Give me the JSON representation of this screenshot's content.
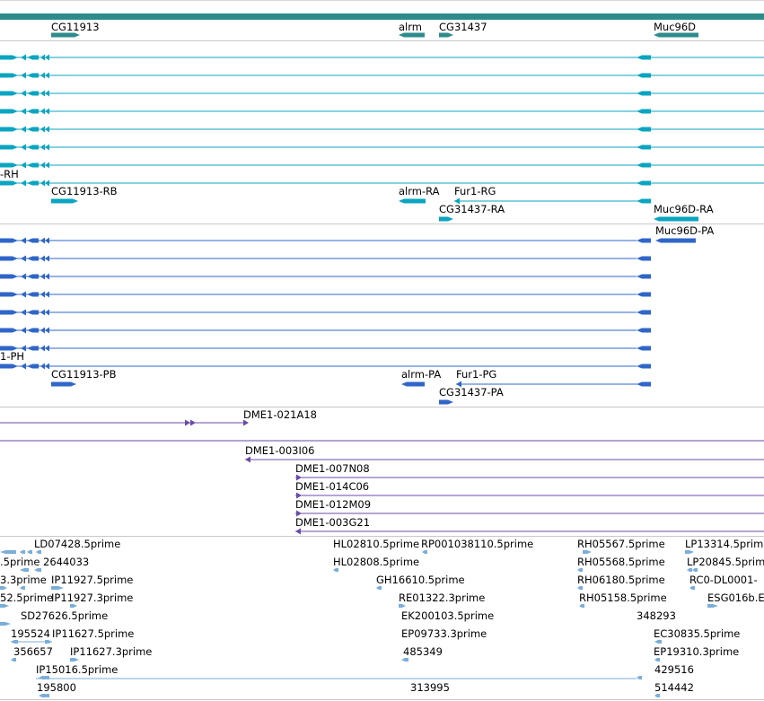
{
  "colors": {
    "gene": "#2e8b8b",
    "tx1": "#0aa5c0",
    "tx2": "#2f66c8",
    "clone": "#6a4aa8",
    "est": "#7aaed8",
    "divider": "#c8c8c8",
    "bar": "#2e8b8b"
  },
  "genes": [
    {
      "label": "CG11913"
    },
    {
      "label": "alrm"
    },
    {
      "label": "CG31437"
    },
    {
      "label": "Muc96D"
    }
  ],
  "tx1_labels": [
    {
      "label": "-RH"
    },
    {
      "label": "CG11913-RB"
    },
    {
      "label": "alrm-RA"
    },
    {
      "label": "Fur1-RG"
    },
    {
      "label": "CG31437-RA"
    },
    {
      "label": "Muc96D-RA"
    }
  ],
  "tx2_labels": [
    {
      "label": "Muc96D-PA"
    },
    {
      "label": "1-PH"
    },
    {
      "label": "CG11913-PB"
    },
    {
      "label": "alrm-PA"
    },
    {
      "label": "Fur1-PG"
    },
    {
      "label": "CG31437-PA"
    }
  ],
  "clones": [
    {
      "label": "DME1-021A18"
    },
    {
      "label": "DME1-003I06"
    },
    {
      "label": "DME1-007N08"
    },
    {
      "label": "DME1-014C06"
    },
    {
      "label": "DME1-012M09"
    },
    {
      "label": "DME1-003G21"
    }
  ],
  "ests": [
    {
      "label": "LD07428.5prime"
    },
    {
      "label": ".5prime"
    },
    {
      "label": "2644033"
    },
    {
      "label": "3.3prime"
    },
    {
      "label": "IP11927.5prime"
    },
    {
      "label": "52.5prime"
    },
    {
      "label": "IP11927.3prime"
    },
    {
      "label": "SD27626.5prime"
    },
    {
      "label": "195524"
    },
    {
      "label": "IP11627.5prime"
    },
    {
      "label": "356657"
    },
    {
      "label": "IP11627.3prime"
    },
    {
      "label": "IP15016.5prime"
    },
    {
      "label": "195800"
    },
    {
      "label": "HL02810.5prime"
    },
    {
      "label": "RP001038110.5prime"
    },
    {
      "label": "HL02808.5prime"
    },
    {
      "label": "GH16610.5prime"
    },
    {
      "label": "RE01322.3prime"
    },
    {
      "label": "EK200103.5prime"
    },
    {
      "label": "EP09733.3prime"
    },
    {
      "label": "485349"
    },
    {
      "label": "313995"
    },
    {
      "label": "RH05567.5prime"
    },
    {
      "label": "RH05568.5prime"
    },
    {
      "label": "RH06180.5prime"
    },
    {
      "label": "RH05158.5prime"
    },
    {
      "label": "348293"
    },
    {
      "label": "EC30835.5prime"
    },
    {
      "label": "EP19310.3prime"
    },
    {
      "label": "429516"
    },
    {
      "label": "514442"
    },
    {
      "label": "LP13314.5prime"
    },
    {
      "label": "LP20845.5prime"
    },
    {
      "label": "RC0-DL0001-"
    },
    {
      "label": "ESG016b.E"
    }
  ]
}
